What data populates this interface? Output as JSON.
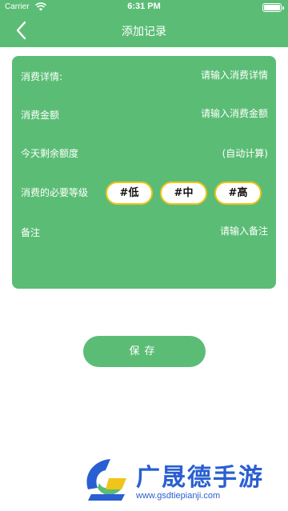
{
  "status_bar": {
    "carrier": "Carrier",
    "time": "6:31 PM"
  },
  "nav": {
    "title": "添加记录"
  },
  "form": {
    "detail_label": "消费详情:",
    "detail_placeholder": "请输入消费详情",
    "amount_label": "消费金额",
    "amount_placeholder": "请输入消费金额",
    "remaining_label": "今天剩余额度",
    "remaining_value": "(自动计算)",
    "level_label": "消费的必要等级",
    "levels": [
      "#低",
      "#中",
      "#高"
    ],
    "note_label": "备注",
    "note_placeholder": "请输入备注"
  },
  "save_label": "保存",
  "watermark": {
    "text": "广晟德手游",
    "url": "www.gsdtiepianji.com"
  },
  "colors": {
    "primary": "#5bbd75",
    "pill_border": "#f0c419",
    "watermark": "#2a5fd1"
  }
}
